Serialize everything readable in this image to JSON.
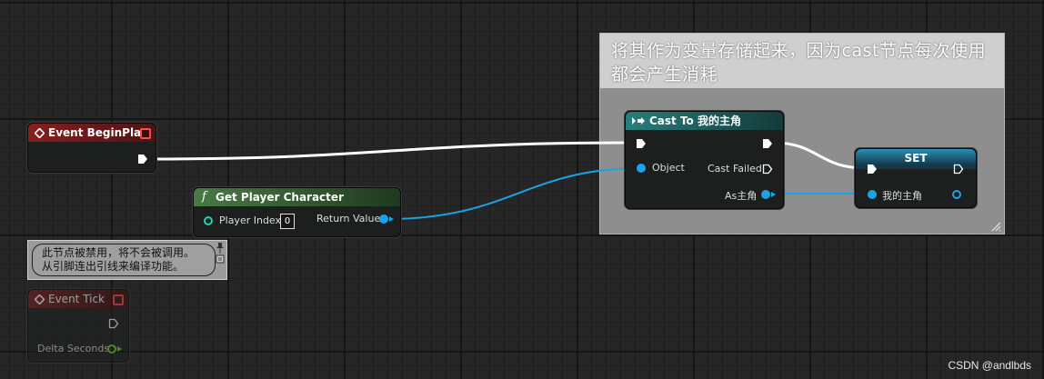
{
  "comment": {
    "title": "将其作为变量存储起来，因为cast节点每次使用都会产生消耗"
  },
  "nodes": {
    "event_begin_play": {
      "title": "Event BeginPlay"
    },
    "get_player_character": {
      "title": "Get Player Character",
      "player_index_label": "Player Index",
      "player_index_value": "0",
      "return_value_label": "Return Value"
    },
    "cast_to": {
      "title": "Cast To 我的主角",
      "object_label": "Object",
      "cast_failed_label": "Cast Failed",
      "as_label": "As主角"
    },
    "set": {
      "title": "SET",
      "var_label": "我的主角"
    },
    "event_tick": {
      "title": "Event Tick",
      "delta_seconds_label": "Delta Seconds",
      "disabled_message": "此节点被禁用，将不会被调用。\n从引脚连出引线来编译功能。"
    }
  },
  "colors": {
    "event_header": "#7a1b1b",
    "function_header": "#3f6b3a",
    "cast_header": "#1f6b6b",
    "set_header": "#17617a",
    "object_pin": "#1aa3e6",
    "float_pin": "#6edb2a",
    "exec": "#ffffff"
  },
  "watermark": "CSDN @andlbds"
}
